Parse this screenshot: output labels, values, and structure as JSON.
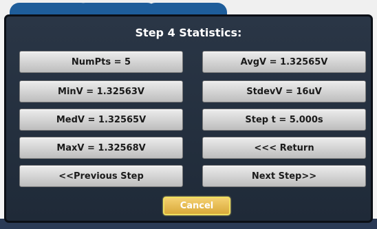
{
  "dialog": {
    "title": "Step 4 Statistics:",
    "buttons": {
      "numpts": "NumPts = 5",
      "avgv": "AvgV = 1.32565V",
      "minv": "MinV = 1.32563V",
      "stdevv": "StdevV = 16uV",
      "medv": "MedV = 1.32565V",
      "step_t": "Step t = 5.000s",
      "maxv": "MaxV = 1.32568V",
      "return": "<<< Return",
      "previous_step": "<<Previous Step",
      "next_step": "Next Step>>"
    },
    "cancel": "Cancel"
  },
  "colors": {
    "dialog_bg": "#243040",
    "button_bg": "#d6d6d6",
    "cancel_bg": "#e6b84a",
    "cancel_border": "#f0e060",
    "tab_bg": "#1e5d9a"
  }
}
